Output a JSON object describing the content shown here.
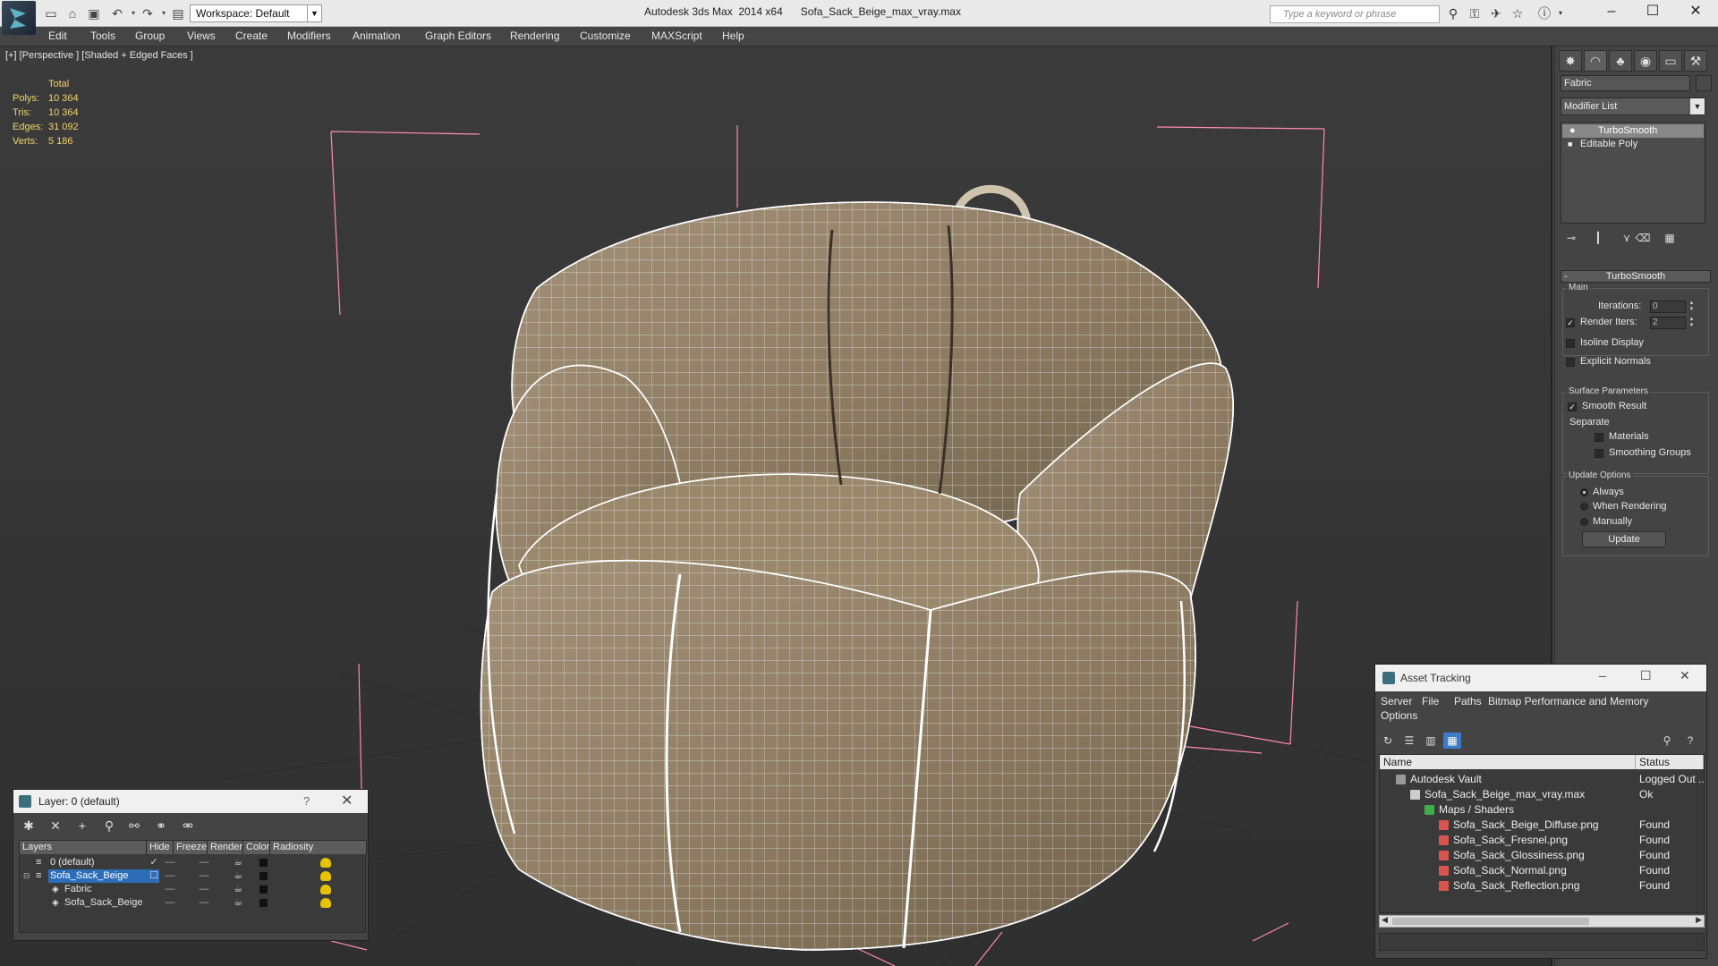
{
  "titlebar": {
    "workspace": "Workspace: Default",
    "app_name": "Autodesk 3ds Max  2014 x64",
    "file_name": "Sofa_Sack_Beige_max_vray.max",
    "search_placeholder": "Type a keyword or phrase"
  },
  "menu": [
    "Edit",
    "Tools",
    "Group",
    "Views",
    "Create",
    "Modifiers",
    "Animation",
    "Graph Editors",
    "Rendering",
    "Customize",
    "MAXScript",
    "Help"
  ],
  "viewport": {
    "label": "[+] [Perspective ] [Shaded + Edged Faces ]",
    "stats": {
      "header": "Total",
      "polys_label": "Polys:",
      "polys": "10 364",
      "tris_label": "Tris:",
      "tris": "10 364",
      "edges_label": "Edges:",
      "edges": "31 092",
      "verts_label": "Verts:",
      "verts": "5 186"
    }
  },
  "command_panel": {
    "object_name": "Fabric",
    "modifier_list": "Modifier List",
    "stack": [
      "TurboSmooth",
      "Editable Poly"
    ],
    "rollout_title": "TurboSmooth",
    "main_group": "Main",
    "iterations_label": "Iterations:",
    "iterations": "0",
    "render_iters_label": "Render Iters:",
    "render_iters": "2",
    "isoline_display": "Isoline Display",
    "explicit_normals": "Explicit Normals",
    "surface_group": "Surface Parameters",
    "smooth_result": "Smooth Result",
    "separate": "Separate",
    "materials": "Materials",
    "smoothing_groups": "Smoothing Groups",
    "update_group": "Update Options",
    "always": "Always",
    "when_rendering": "When Rendering",
    "manually": "Manually",
    "update_button": "Update"
  },
  "layer_dialog": {
    "title": "Layer: 0 (default)",
    "help": "?",
    "columns": [
      "Layers",
      "Hide",
      "Freeze",
      "Render",
      "Color",
      "Radiosity"
    ],
    "rows": [
      "0 (default)",
      "Sofa_Sack_Beige",
      "Fabric",
      "Sofa_Sack_Beige"
    ]
  },
  "asset_tracking": {
    "title": "Asset Tracking",
    "menu": [
      "Server",
      "File",
      "Paths",
      "Bitmap Performance and Memory",
      "Options"
    ],
    "columns": [
      "Name",
      "Status"
    ],
    "rows": [
      {
        "name": "Autodesk Vault",
        "status": "Logged Out ..."
      },
      {
        "name": "Sofa_Sack_Beige_max_vray.max",
        "status": "Ok"
      },
      {
        "name": "Maps / Shaders",
        "status": ""
      },
      {
        "name": "Sofa_Sack_Beige_Diffuse.png",
        "status": "Found"
      },
      {
        "name": "Sofa_Sack_Fresnel.png",
        "status": "Found"
      },
      {
        "name": "Sofa_Sack_Glossiness.png",
        "status": "Found"
      },
      {
        "name": "Sofa_Sack_Normal.png",
        "status": "Found"
      },
      {
        "name": "Sofa_Sack_Reflection.png",
        "status": "Found"
      }
    ]
  },
  "colors": {
    "viewport_bg": "#383838",
    "stats_text": "#f3d36a",
    "selection_bracket": "#ff8ab0",
    "model_fill": "#9b8a6e",
    "selected_row": "#2d6db8"
  }
}
